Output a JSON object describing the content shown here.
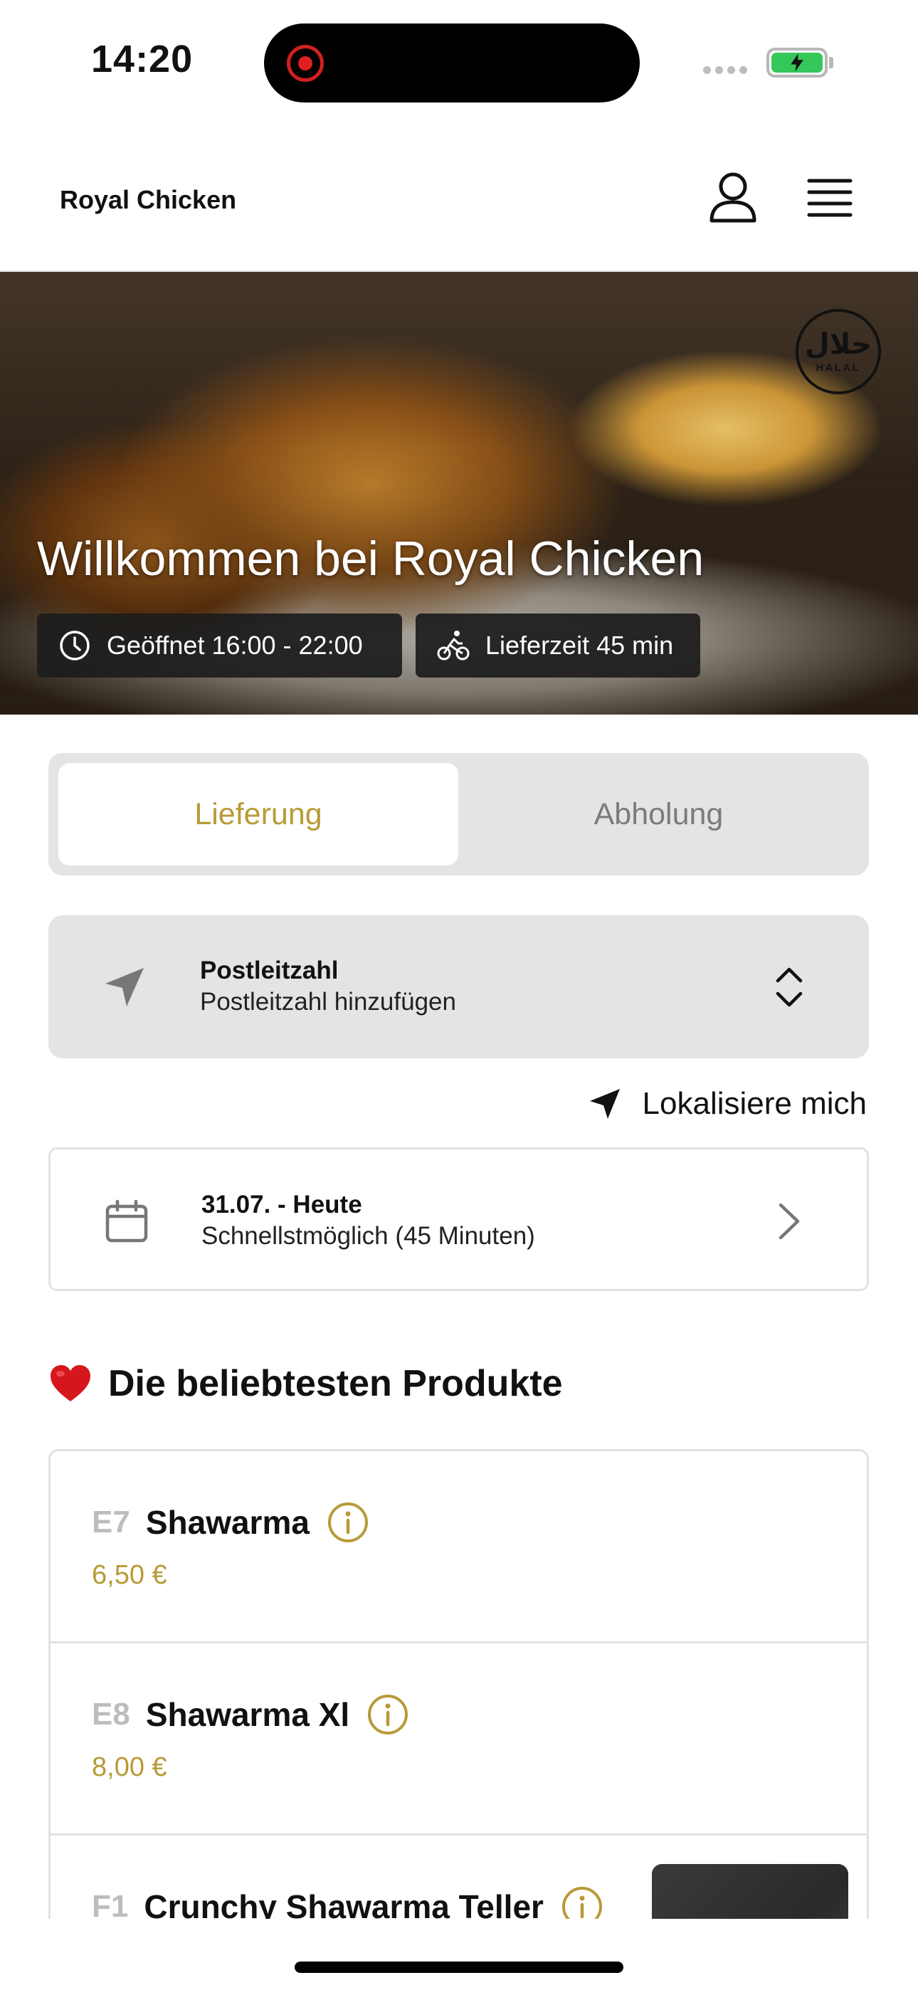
{
  "status_bar": {
    "time": "14:20"
  },
  "header": {
    "brand": "Royal Chicken"
  },
  "hero": {
    "title": "Willkommen bei Royal Chicken",
    "badge_arabic": "حلال",
    "badge_latin": "HALAL",
    "opening_hours": "Geöffnet 16:00 - 22:00",
    "delivery_time": "Lieferzeit 45 min"
  },
  "order_mode": {
    "options": [
      "Lieferung",
      "Abholung"
    ],
    "selected": "Lieferung",
    "active_color": "#b89a36"
  },
  "postcode": {
    "label": "Postleitzahl",
    "placeholder": "Postleitzahl hinzufügen"
  },
  "locate": {
    "label": "Lokalisiere mich"
  },
  "schedule": {
    "date": "31.07. - Heute",
    "time": "Schnellstmöglich (45 Minuten)"
  },
  "popular": {
    "title": "Die beliebtesten Produkte",
    "products": [
      {
        "code": "E7",
        "name": "Shawarma",
        "price": "6,50 €"
      },
      {
        "code": "E8",
        "name": "Shawarma Xl",
        "price": "8,00 €"
      },
      {
        "code": "F1",
        "name": "Crunchy Shawarma Teller",
        "price": ""
      }
    ]
  },
  "colors": {
    "accent": "#b89a36",
    "segment_bg": "#e4e4e4",
    "battery": "#34c759"
  }
}
